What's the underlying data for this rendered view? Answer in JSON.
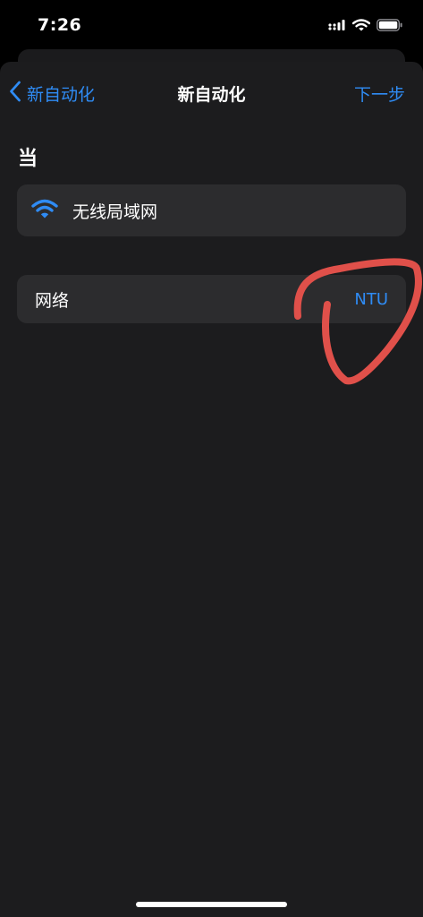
{
  "status_bar": {
    "time": "7:26",
    "icons": [
      "cellular-icon",
      "wifi-icon",
      "battery-icon"
    ]
  },
  "nav": {
    "back_label": "新自动化",
    "title": "新自动化",
    "next_label": "下一步"
  },
  "section": {
    "title": "当"
  },
  "trigger": {
    "icon": "wifi-icon",
    "label": "无线局域网"
  },
  "network": {
    "label": "网络",
    "value": "NTU"
  },
  "colors": {
    "accent": "#2f8cf5",
    "sheet_background": "#1c1c1e",
    "card_background": "#2c2c2e",
    "annotation_stroke": "#e0504a"
  }
}
